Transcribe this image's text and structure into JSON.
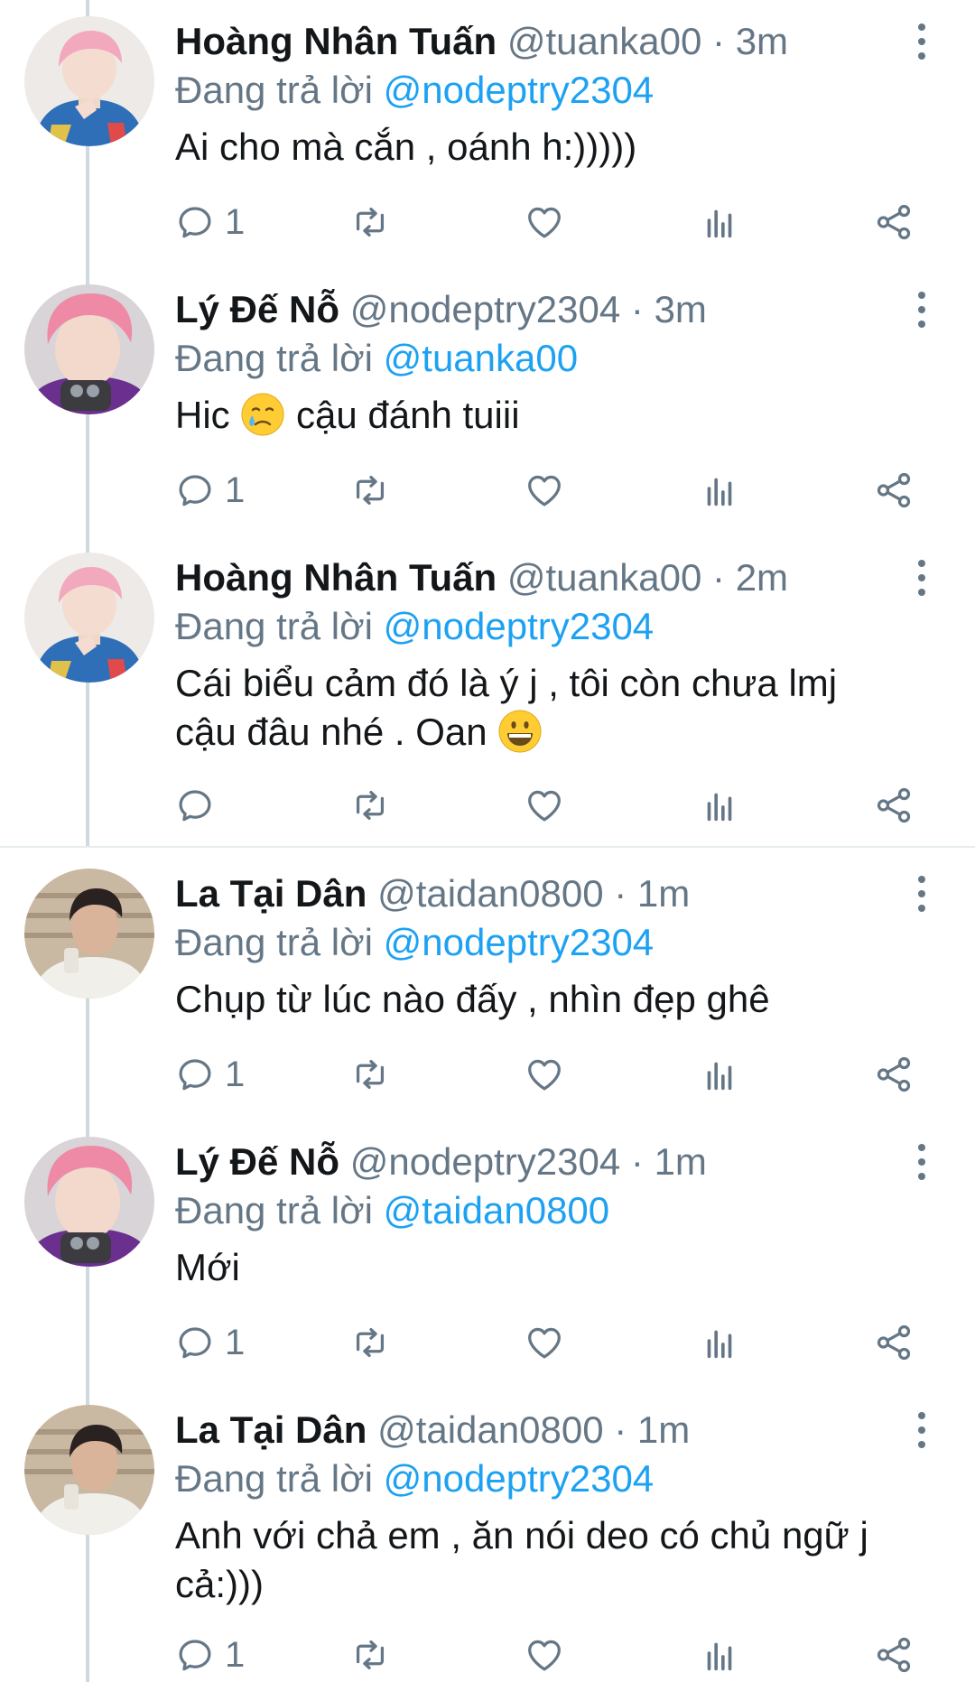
{
  "colors": {
    "name": "#14171a",
    "secondary": "#657786",
    "link": "#1da1f2",
    "thread_line": "#cfd9de",
    "divider": "#e6ecf0"
  },
  "replying_label": "Đang trả lời",
  "tweets": [
    {
      "name": "Hoàng Nhân Tuấn",
      "handle": "@tuanka00",
      "dot": "·",
      "time": "3m",
      "reply_to": "@nodeptry2304",
      "text_lines": [
        "Ai cho mà cắn , oánh h:)))))"
      ],
      "reply_count": "1",
      "avatar": "pink-hair-person-avatar"
    },
    {
      "name": "Lý Đế Nỗ",
      "handle": "@nodeptry2304",
      "dot": "·",
      "time": "3m",
      "reply_to": "@tuanka00",
      "text_lines": [
        "Hic",
        "cậu đánh tuiii"
      ],
      "emoji": "crying-face-emoji",
      "reply_count": "1",
      "avatar": "pink-hair-selfie-avatar"
    },
    {
      "name": "Hoàng Nhân Tuấn",
      "handle": "@tuanka00",
      "dot": "·",
      "time": "2m",
      "reply_to": "@nodeptry2304",
      "text_lines": [
        "Cái biểu cảm đó là ý j , tôi còn chưa lmj",
        "cậu đâu nhé . Oan"
      ],
      "emoji": "grinning-face-emoji",
      "reply_count": "",
      "avatar": "pink-hair-person-avatar"
    },
    {
      "name": "La Tại Dân",
      "handle": "@taidan0800",
      "dot": "·",
      "time": "1m",
      "reply_to": "@nodeptry2304",
      "text_lines": [
        "Chụp từ lúc nào đấy , nhìn đẹp ghê"
      ],
      "reply_count": "1",
      "avatar": "dark-hair-person-avatar"
    },
    {
      "name": "Lý Đế Nỗ",
      "handle": "@nodeptry2304",
      "dot": "·",
      "time": "1m",
      "reply_to": "@taidan0800",
      "text_lines": [
        "Mới"
      ],
      "reply_count": "1",
      "avatar": "pink-hair-selfie-avatar"
    },
    {
      "name": "La Tại Dân",
      "handle": "@taidan0800",
      "dot": "·",
      "time": "1m",
      "reply_to": "@nodeptry2304",
      "text_lines": [
        "Anh với chả em , ăn nói deo có chủ ngữ j",
        "cả:)))"
      ],
      "reply_count": "1",
      "avatar": "dark-hair-person-avatar"
    }
  ]
}
